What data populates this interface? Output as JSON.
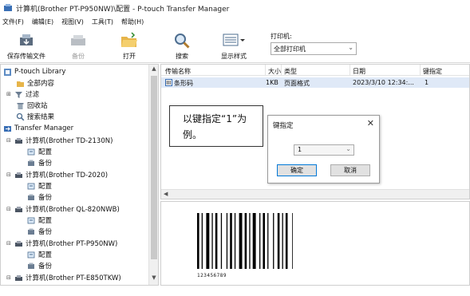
{
  "window": {
    "title": "计算机(Brother PT-P950NW)\\配置 - P-touch Transfer Manager"
  },
  "menu": [
    {
      "label": "文件(F)"
    },
    {
      "label": "编辑(E)"
    },
    {
      "label": "视图(V)"
    },
    {
      "label": "工具(T)"
    },
    {
      "label": "帮助(H)"
    }
  ],
  "toolbar": {
    "save_transfer": "保存传输文件",
    "backup": "备份",
    "open": "打开",
    "search": "搜索",
    "view_style": "显示样式",
    "printer_label": "打印机:",
    "printer_value": "全部打印机"
  },
  "tree": {
    "items": [
      {
        "label": "P-touch Library",
        "icon": "library-icon"
      },
      {
        "label": "全部内容",
        "icon": "folder-icon"
      },
      {
        "label": "过滤",
        "icon": "filter-icon"
      },
      {
        "label": "回收站",
        "icon": "recycle-bin-icon"
      },
      {
        "label": "搜索结果",
        "icon": "search-icon"
      },
      {
        "label": "Transfer Manager",
        "icon": "transfer-icon"
      },
      {
        "label": "计算机(Brother TD-2130N)",
        "icon": "printer-icon"
      },
      {
        "label": "配置",
        "icon": "config-icon"
      },
      {
        "label": "备份",
        "icon": "backup-icon"
      },
      {
        "label": "计算机(Brother TD-2020)",
        "icon": "printer-icon"
      },
      {
        "label": "配置",
        "icon": "config-icon"
      },
      {
        "label": "备份",
        "icon": "backup-icon"
      },
      {
        "label": "计算机(Brother QL-820NWB)",
        "icon": "printer-icon"
      },
      {
        "label": "配置",
        "icon": "config-icon"
      },
      {
        "label": "备份",
        "icon": "backup-icon"
      },
      {
        "label": "计算机(Brother PT-P950NW)",
        "icon": "printer-icon"
      },
      {
        "label": "配置",
        "icon": "config-icon"
      },
      {
        "label": "备份",
        "icon": "backup-icon"
      },
      {
        "label": "计算机(Brother PT-E850TKW)",
        "icon": "printer-icon"
      }
    ]
  },
  "file_list": {
    "columns": [
      "传输名称",
      "大小",
      "类型",
      "日期",
      "键指定"
    ],
    "rows": [
      {
        "name": "条形码",
        "size": "1KB",
        "type": "页面格式",
        "date": "2023/3/10 12:34:...",
        "key": "1"
      }
    ]
  },
  "preview": {
    "barcode_number": "123456789"
  },
  "annotation": {
    "line1": "以键指定“1”为",
    "line2": "例。"
  },
  "dialog": {
    "title": "键指定",
    "close": "✕",
    "select_value": "1",
    "ok": "确定",
    "cancel": "取消"
  },
  "colors": {
    "selection": "#dfe9f7",
    "accent": "#0078d7"
  }
}
